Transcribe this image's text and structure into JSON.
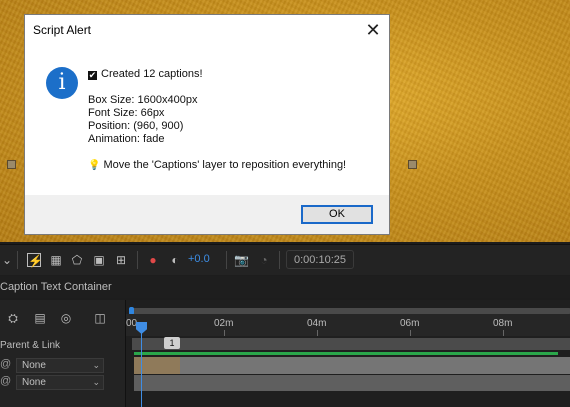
{
  "dialog": {
    "title": "Script Alert",
    "close_glyph": "✕",
    "info_glyph": "i",
    "check_glyph": "✔",
    "created": "Created 12 captions!",
    "box_size": "Box Size: 1600x400px",
    "font_size": "Font Size: 66px",
    "position": "Position: (960, 900)",
    "animation": "Animation: fade",
    "bulb_glyph": "💡",
    "tip": "Move the 'Captions' layer to reposition everything!",
    "ok_label": "OK"
  },
  "toolbar": {
    "plus_value": "+0.0",
    "timecode": "0:00:10:25"
  },
  "timeline": {
    "comp_name": "Caption Text Container",
    "column_header": "Parent & Link",
    "ruler_labels": [
      "00",
      "02m",
      "04m",
      "06m",
      "08m"
    ],
    "marker_label": "1",
    "parent_rows": [
      {
        "value": "None"
      },
      {
        "value": "None"
      }
    ]
  },
  "colors": {
    "accent": "#3f8de4",
    "info_icon": "#1c6fc9",
    "work_area_green": "#2aa64a"
  }
}
